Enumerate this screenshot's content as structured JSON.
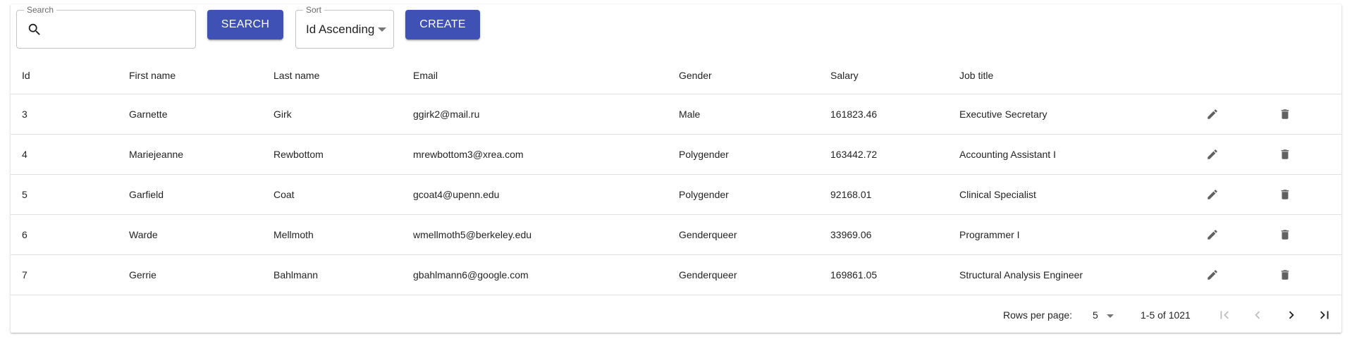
{
  "toolbar": {
    "search_legend": "Search",
    "search_value": "",
    "search_button": "SEARCH",
    "sort_legend": "Sort",
    "sort_value": "Id Ascending",
    "create_button": "CREATE"
  },
  "table": {
    "headers": [
      "Id",
      "First name",
      "Last name",
      "Email",
      "Gender",
      "Salary",
      "Job title"
    ],
    "rows": [
      [
        "3",
        "Garnette",
        "Girk",
        "ggirk2@mail.ru",
        "Male",
        "161823.46",
        "Executive Secretary"
      ],
      [
        "4",
        "Mariejeanne",
        "Rewbottom",
        "mrewbottom3@xrea.com",
        "Polygender",
        "163442.72",
        "Accounting Assistant I"
      ],
      [
        "5",
        "Garfield",
        "Coat",
        "gcoat4@upenn.edu",
        "Polygender",
        "92168.01",
        "Clinical Specialist"
      ],
      [
        "6",
        "Warde",
        "Mellmoth",
        "wmellmoth5@berkeley.edu",
        "Genderqueer",
        "33969.06",
        "Programmer I"
      ],
      [
        "7",
        "Gerrie",
        "Bahlmann",
        "gbahlmann6@google.com",
        "Genderqueer",
        "169861.05",
        "Structural Analysis Engineer"
      ]
    ],
    "row_actions": [
      "edit-icon",
      "delete-icon"
    ]
  },
  "pagination": {
    "rows_per_page_label": "Rows per page:",
    "rows_per_page_value": "5",
    "range_label": "1-5 of 1021"
  },
  "colors": {
    "primary": "#3f51b5",
    "icon": "#616161"
  }
}
